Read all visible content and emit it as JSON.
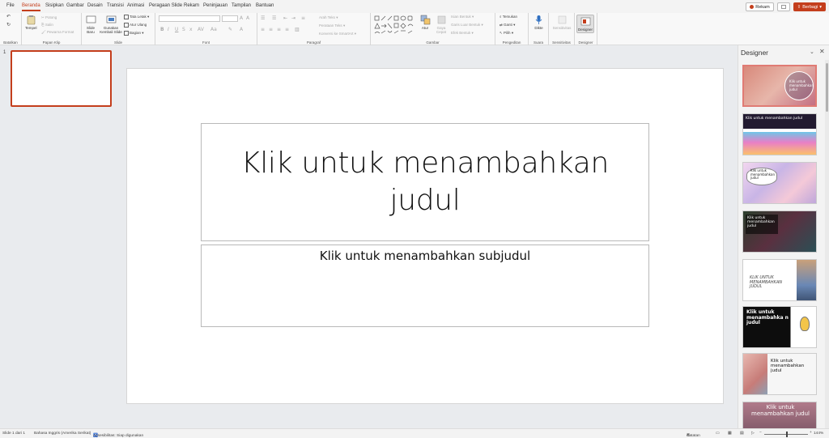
{
  "tabs": [
    "File",
    "Beranda",
    "Sisipkan",
    "Gambar",
    "Desain",
    "Transisi",
    "Animasi",
    "Peragaan Slide",
    "Rekam",
    "Peninjauan",
    "Tampilan",
    "Bantuan"
  ],
  "active_tab": "Beranda",
  "top_right": {
    "record": "Rekam",
    "share": "Berbagi"
  },
  "ribbon": {
    "groups": {
      "undo": "Batalkan",
      "clipboard": "Papan Klip",
      "slides": "Slide",
      "font": "Font",
      "paragraph": "Paragraf",
      "drawing": "Gambar",
      "editing": "Pengeditan",
      "voice": "Suara",
      "sensitivity": "Sensitivitas",
      "designer": "Designer"
    },
    "clipboard": {
      "paste": "Tempel",
      "cut": "Potong",
      "copy": "Salin",
      "format_painter": "Pewarna Format"
    },
    "slides": {
      "new_slide": "Slide Baru",
      "reuse": "Gunakan Kembali Slide",
      "layout": "Tata Letak",
      "reset": "Atur Ulang",
      "section": "Bagian"
    },
    "paragraph": {
      "text_direction": "Arah Teks",
      "align_text": "Perataan Teks",
      "smartart": "Konversi ke SmartArt"
    },
    "drawing": {
      "arrange": "Atur",
      "quick_styles": "Gaya Cepat",
      "shape_fill": "Isian Bentuk",
      "shape_outline": "Garis Luar Bentuk",
      "shape_effects": "Efek Bentuk"
    },
    "editing": {
      "find": "Temukan",
      "replace": "Ganti",
      "select": "Pilih"
    },
    "voice": {
      "dictate": "Dikte"
    },
    "sensitivity": {
      "label": "Sensitivitas"
    },
    "designer": {
      "label": "Designer"
    }
  },
  "thumbnail": {
    "number": "1"
  },
  "slide": {
    "title_placeholder": "Klik untuk menambahkan judul",
    "subtitle_placeholder": "Klik untuk menambahkan subjudul"
  },
  "designer_pane": {
    "title": "Designer",
    "designs": [
      {
        "text": "Klik untuk menambahkan judul",
        "bg": "#d98c7e"
      },
      {
        "text": "Klik untuk menambahkan judul",
        "bg": "#2b1f3a"
      },
      {
        "text": "Klik untuk menambahkan judul",
        "bg": "#e8cde6"
      },
      {
        "text": "Klik untuk menambahkan judul",
        "bg": "#2f3a2c"
      },
      {
        "text": "KLIK UNTUK MENAMBAHKAN JUDUL",
        "bg": "#ffffff"
      },
      {
        "text": "Klik untuk menambahka n judul",
        "bg": "#111111"
      },
      {
        "text": "Klik untuk menambahkan judul",
        "bg": "#f6f6f6"
      },
      {
        "text": "Klik untuk menambahkan judul",
        "bg": "#8a5a6c"
      }
    ]
  },
  "status_bar": {
    "slide_info": "Slide 1 dari 1",
    "language": "Bahasa Inggris (Amerika Serikat)",
    "accessibility": "Aksesibilitas: Siap digunakan",
    "notes": "Catatan",
    "zoom": "144%"
  },
  "colors": {
    "accent": "#c43e1c",
    "ribbon_bg": "#f8f8f8",
    "canvas_bg": "#e9ebee"
  }
}
